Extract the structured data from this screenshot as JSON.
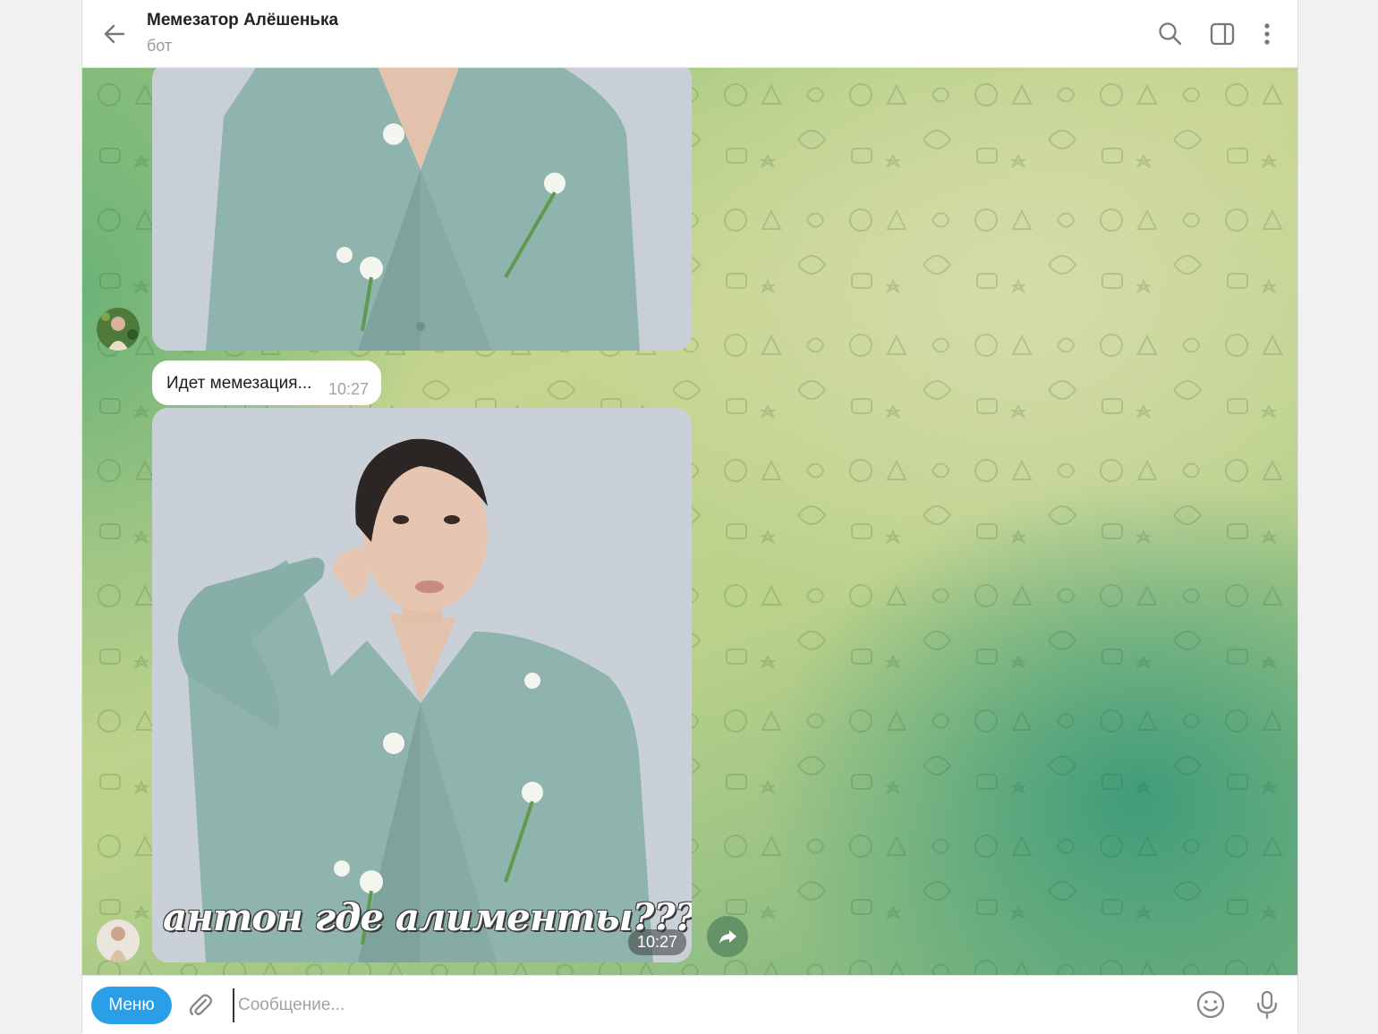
{
  "header": {
    "title": "Мемезатор Алёшенька",
    "subtitle": "бот",
    "icons": [
      "back-arrow-icon",
      "search-icon",
      "sidebar-toggle-icon",
      "more-vertical-icon"
    ]
  },
  "messages": {
    "status_text": "Идет мемезация...",
    "status_time": "10:27",
    "meme_caption": "антон где алименты???",
    "meme_time": "10:27"
  },
  "input": {
    "menu_label": "Меню",
    "placeholder": "Сообщение..."
  },
  "colors": {
    "accent": "#2a9ee6",
    "jacket": "#8fb3ad",
    "background": "#b9d18a"
  }
}
